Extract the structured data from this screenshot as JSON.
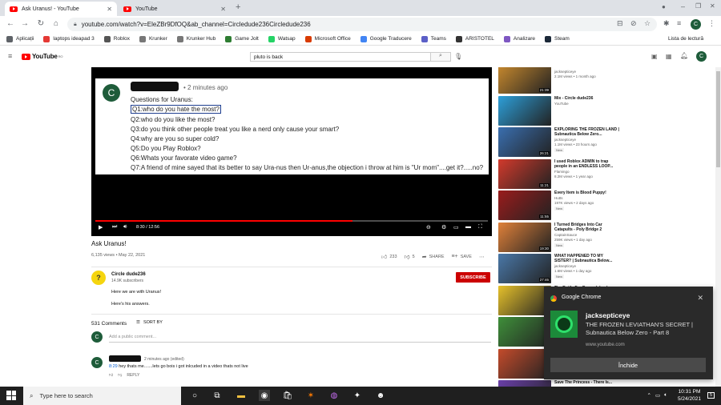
{
  "browser": {
    "tabs": [
      {
        "label": "Ask Uranus! - YouTube",
        "active": true
      },
      {
        "label": "YouTube",
        "active": false
      }
    ],
    "url": "youtube.com/watch?v=EleZBr9DfOQ&ab_channel=Circledude236Circledude236",
    "profile_initial": "C",
    "bookmarks": [
      {
        "label": "Aplicații",
        "color": "#5f6368"
      },
      {
        "label": "laptops ideapad 3",
        "color": "#e53935"
      },
      {
        "label": "Roblox",
        "color": "#555555"
      },
      {
        "label": "Krunker",
        "color": "#777777"
      },
      {
        "label": "Krunker Hub",
        "color": "#777777"
      },
      {
        "label": "Game Jolt",
        "color": "#2e7d32"
      },
      {
        "label": "Watsap",
        "color": "#25d366"
      },
      {
        "label": "Microsoft Office",
        "color": "#d83b01"
      },
      {
        "label": "Google Traducere",
        "color": "#4285f4"
      },
      {
        "label": "Teams",
        "color": "#5b5fc7"
      },
      {
        "label": "ARISTOTEL",
        "color": "#333333"
      },
      {
        "label": "Analizare",
        "color": "#7e57c2"
      },
      {
        "label": "Steam",
        "color": "#1b2838"
      }
    ],
    "reading_list": "Lista de lectură"
  },
  "youtube": {
    "logo_text": "YouTube",
    "logo_region": "RO",
    "search_value": "pluto is back",
    "profile_initial": "C"
  },
  "video": {
    "comment_card": {
      "avatar_initial": "C",
      "time": "2 minutes ago",
      "heading": "Questions for Uranus:",
      "questions": [
        "Q1:who do you hate the most?",
        "Q2:who do you like the most?",
        "Q3:do you think other people treat you like a nerd only cause your smart?",
        "Q4:why are you so super cold?",
        "Q5:Do you Play Roblox?",
        "Q6:Whats your favorate video game?",
        "Q7:A friend of mine sayed that its better to say Ura-nus then Ur-anus,the objection i throw at him is \"Ur mom\"....get it?.....no?"
      ]
    },
    "time_display": "8:30 / 12:56",
    "progress": 0.656,
    "title": "Ask Uranus!",
    "meta": "6,135 views • May 22, 2021",
    "likes": "233",
    "dislikes": "5",
    "share_label": "SHARE",
    "save_label": "SAVE",
    "channel": {
      "name": "Circle dude236",
      "subs": "14.9K subscribers",
      "subscribe_label": "SUBSCRIBE"
    },
    "description": [
      "Here we are with Uranus!",
      "Here's his answers."
    ],
    "comments_count": "531 Comments",
    "sort_label": "SORT BY",
    "add_comment_placeholder": "Add a public comment...",
    "first_comment": {
      "time": "2 minutes ago (edited)",
      "timestamp_link": "8:29",
      "text": " hey thats me.......lets go bois i got inlcuded in a video thats not live",
      "reply_label": "REPLY"
    }
  },
  "recommendations": [
    {
      "title": "",
      "channel": "jacksepticeye",
      "meta": "2.1M views • 1 month ago",
      "duration": "21:39",
      "new": false,
      "thumb": "#c98a2e"
    },
    {
      "title": "Mix - Circle dude236",
      "channel": "YouTube",
      "meta": "",
      "duration": "",
      "new": false,
      "thumb": "#2d9fd9"
    },
    {
      "title": "EXPLORING THE FROZEN LAND | Subnautica Below Zero...",
      "channel": "jacksepticeye",
      "meta": "1.1M views • 23 hours ago",
      "duration": "26:21",
      "new": true,
      "thumb": "#3a6fb0"
    },
    {
      "title": "I used Roblox ADMIN to trap people in an ENDLESS LOOP...",
      "channel": "Flamingo",
      "meta": "8.2M views • 1 year ago",
      "duration": "11:21",
      "new": false,
      "thumb": "#d33a2c"
    },
    {
      "title": "Every Item is Blood Puppy!",
      "channel": "Hutts",
      "meta": "197K views • 2 days ago",
      "duration": "11:55",
      "new": true,
      "thumb": "#9a1c1c"
    },
    {
      "title": "I Turned Bridges Into Car Catapults - Poly Bridge 2",
      "channel": "CaptainSauce",
      "meta": "259K views • 1 day ago",
      "duration": "19:30",
      "new": true,
      "thumb": "#e0813a"
    },
    {
      "title": "WHAT HAPPENED TO MY SISTER? | Subnautica Below...",
      "channel": "jacksepticeye",
      "meta": "1.6M views • 1 day ago",
      "duration": "27:46",
      "new": true,
      "thumb": "#4a78a8"
    },
    {
      "title": "The Battle For Dream Island",
      "channel": "",
      "meta": "",
      "duration": "",
      "new": false,
      "thumb": "#e6c12b"
    },
    {
      "title": "",
      "channel": "",
      "meta": "",
      "duration": "",
      "new": false,
      "thumb": "#3f8f3a"
    },
    {
      "title": "",
      "channel": "",
      "meta": "",
      "duration": "",
      "new": false,
      "thumb": "#c44b2b"
    },
    {
      "title": "Save The Princess - There Is...",
      "channel": "",
      "meta": "",
      "duration": "",
      "new": false,
      "thumb": "#6a3fa8"
    }
  ],
  "notification": {
    "app": "Google Chrome",
    "title": "jacksepticeye",
    "body": "THE FROZEN LEVIATHAN'S SECRET | Subnautica Below Zero - Part 8",
    "url": "www.youtube.com",
    "button": "Închide"
  },
  "taskbar": {
    "search_placeholder": "Type here to search",
    "time": "10:31 PM",
    "date": "5/24/2021",
    "notif_count": "5"
  }
}
